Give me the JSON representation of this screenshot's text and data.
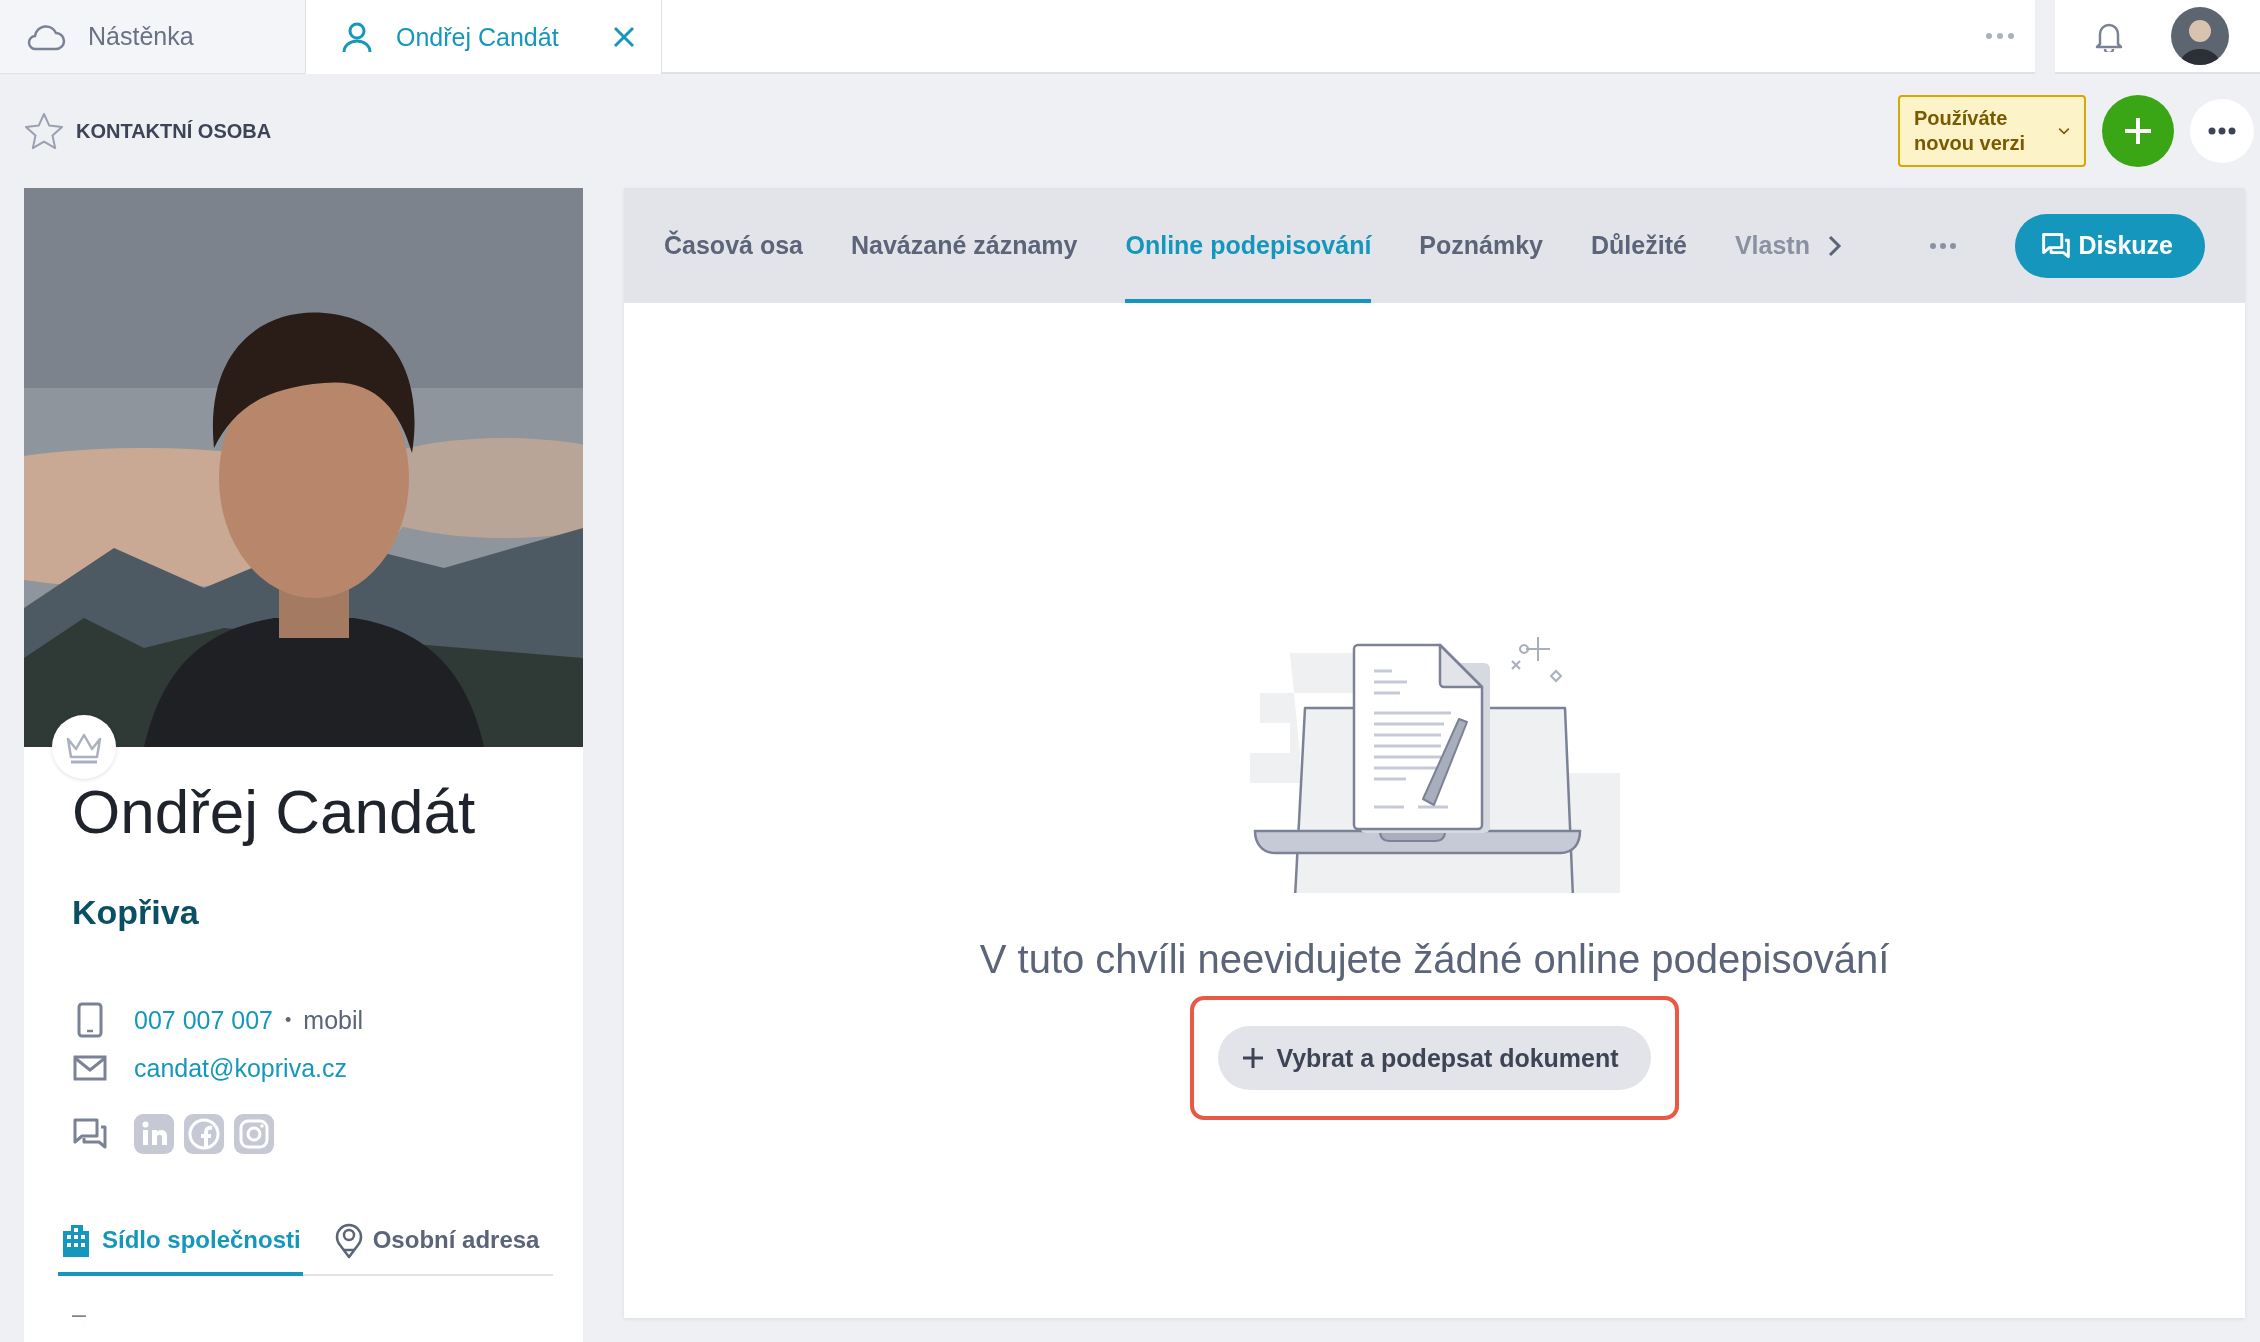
{
  "top_tabs": [
    {
      "label": "Nástěnka",
      "selected": false
    },
    {
      "label": "Ondřej Candát",
      "selected": true
    }
  ],
  "header": {
    "title": "KONTAKTNÍ OSOBA",
    "favorite": false,
    "version_button": "Používáte novou verzi"
  },
  "contact": {
    "name": "Ondřej Candát",
    "company": "Kopřiva",
    "phone": "007 007 007",
    "separator": "•",
    "phone_type": "mobil",
    "email": "candat@kopriva.cz",
    "address_tabs": [
      {
        "label": "Sídlo společnosti",
        "selected": true
      },
      {
        "label": "Osobní adresa",
        "selected": false
      }
    ],
    "address_value": "–"
  },
  "content_tabs": [
    {
      "label": "Časová osa",
      "selected": false
    },
    {
      "label": "Navázané záznamy",
      "selected": false
    },
    {
      "label": "Online podepisování",
      "selected": true
    },
    {
      "label": "Poznámky",
      "selected": false
    },
    {
      "label": "Důležité",
      "selected": false
    },
    {
      "label": "Vlastn",
      "selected": false
    }
  ],
  "discussion_button": "Diskuze",
  "empty_message": "V tuto chvíli neevidujete žádné online podepisování",
  "action_button": {
    "label": "Vybrat a podepsat dokument",
    "highlighted": true
  }
}
